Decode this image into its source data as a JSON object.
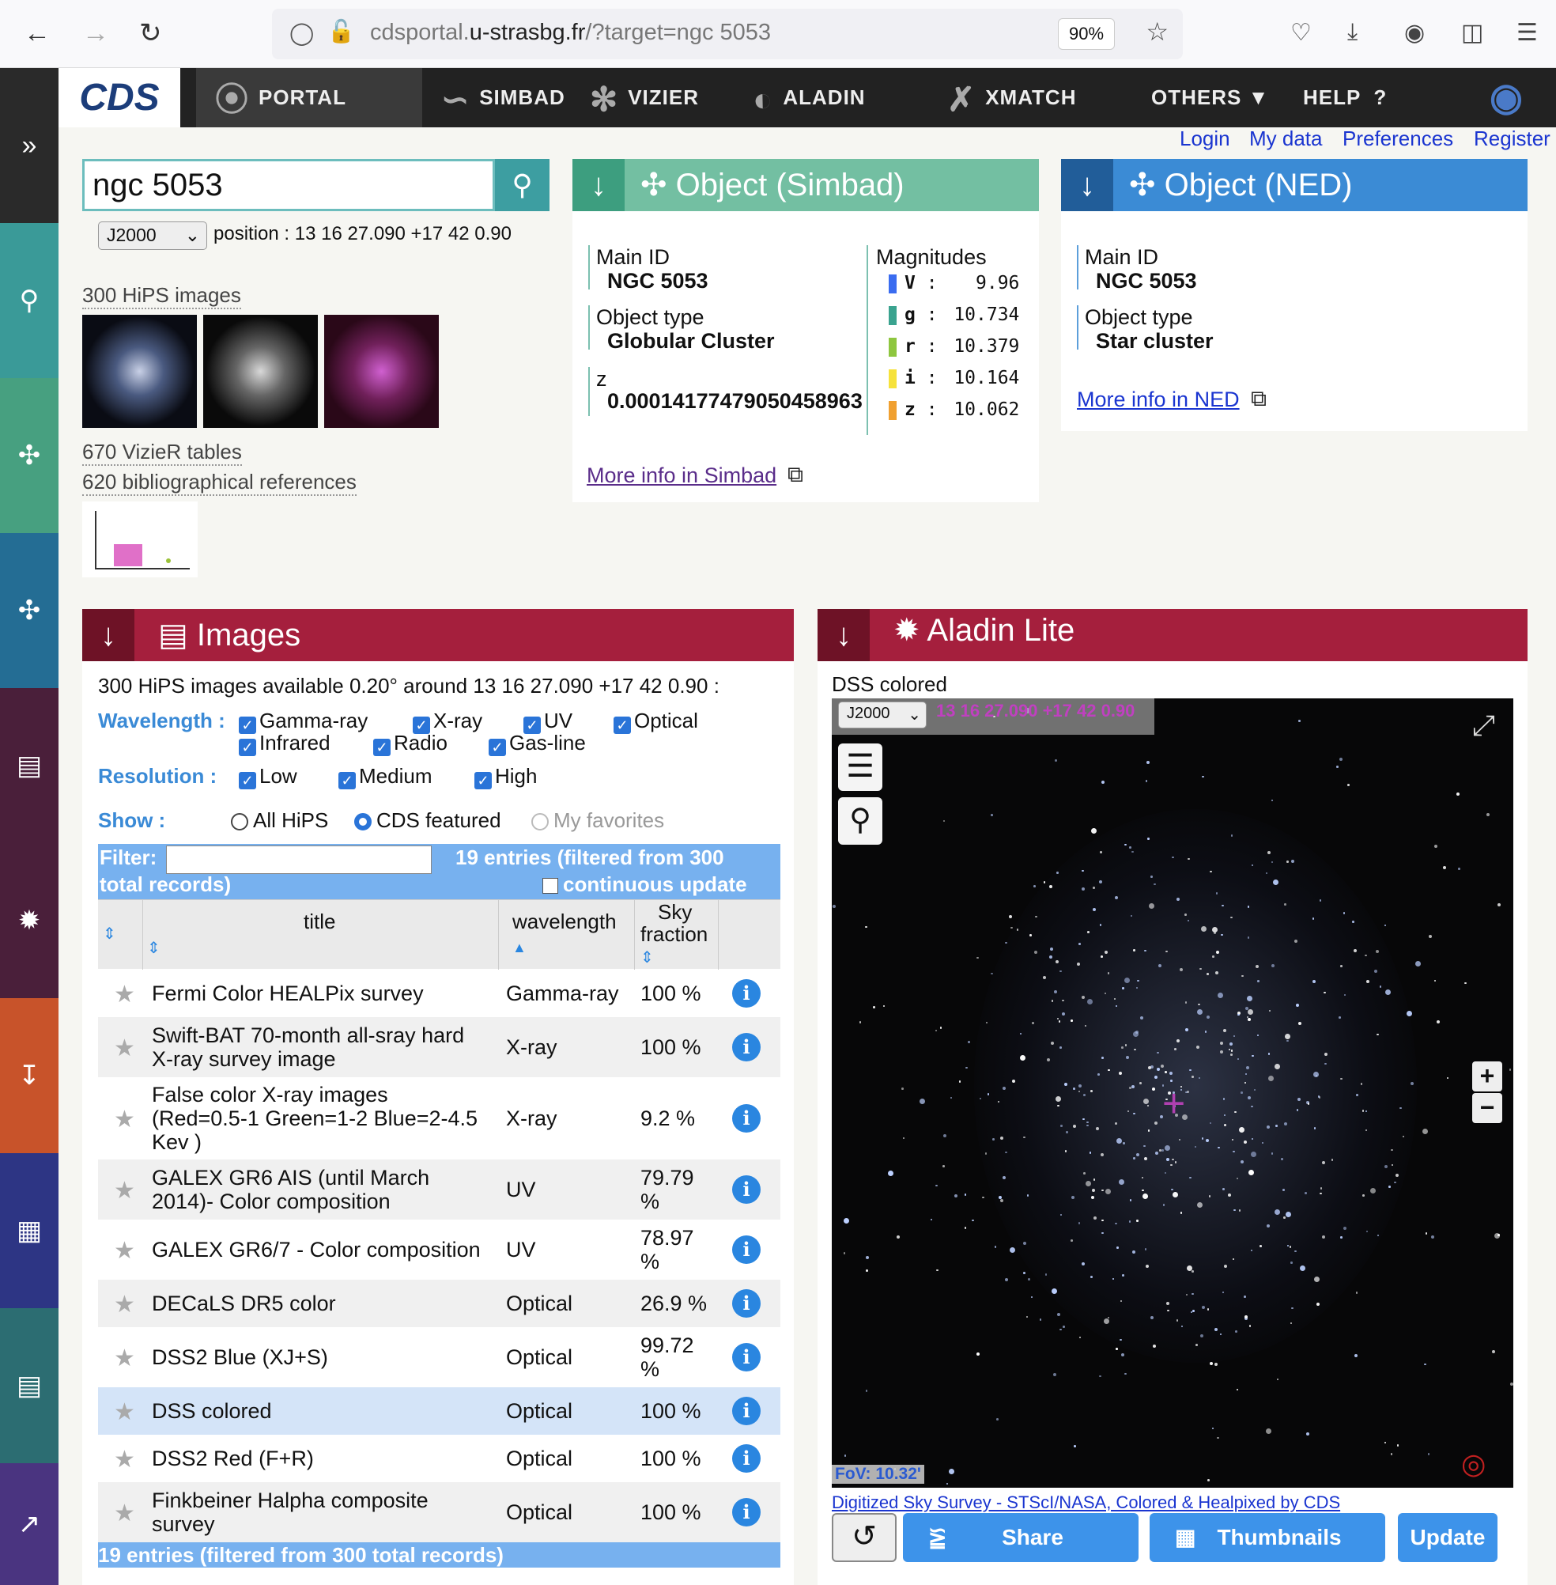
{
  "browser": {
    "url_host_prefix": "cdsportal.",
    "url_host": "u-strasbg.fr",
    "url_path": "/?target=ngc 5053",
    "zoom": "90%"
  },
  "cds_nav": {
    "logo": "CDS",
    "items": [
      "PORTAL",
      "SIMBAD",
      "VIZIER",
      "ALADIN",
      "XMATCH",
      "OTHERS",
      "HELP"
    ],
    "help_mark": "?"
  },
  "user_links": [
    "Login",
    "My data",
    "Preferences",
    "Register"
  ],
  "search": {
    "value": "ngc 5053",
    "frame": "J2000",
    "position": "position : 13 16 27.090 +17 42 0.90"
  },
  "summary": {
    "hips": "300 HiPS images",
    "vizier": "670 VizieR tables",
    "biblio": "620 bibliographical references"
  },
  "simbad": {
    "header": "Object (Simbad)",
    "main_id_label": "Main ID",
    "main_id": "NGC 5053",
    "type_label": "Object type",
    "type": "Globular Cluster",
    "z_label": "z",
    "z": "0.00014177479050458963",
    "mag_label": "Magnitudes",
    "mags": [
      {
        "band": "V",
        "value": "9.96",
        "color": "#3a6cf0"
      },
      {
        "band": "g",
        "value": "10.734",
        "color": "#3aa38f"
      },
      {
        "band": "r",
        "value": "10.379",
        "color": "#8ec63f"
      },
      {
        "band": "i",
        "value": "10.164",
        "color": "#f6e23b"
      },
      {
        "band": "z",
        "value": "10.062",
        "color": "#f0a030"
      }
    ],
    "more": "More info in Simbad"
  },
  "ned": {
    "header": "Object (NED)",
    "main_id_label": "Main ID",
    "main_id": "NGC 5053",
    "type_label": "Object type",
    "type": "Star cluster",
    "more": "More info in NED"
  },
  "images": {
    "header": "Images",
    "available": "300 HiPS images available 0.20° around 13 16 27.090 +17 42 0.90 :",
    "wavelength_label": "Wavelength :",
    "wavelengths": [
      "Gamma-ray",
      "X-ray",
      "UV",
      "Optical",
      "Infrared",
      "Radio",
      "Gas-line"
    ],
    "resolution_label": "Resolution :",
    "resolutions": [
      "Low",
      "Medium",
      "High"
    ],
    "show_label": "Show :",
    "show_options": [
      "All HiPS",
      "CDS featured",
      "My favorites"
    ],
    "filter_label": "Filter:",
    "filter_info": "19 entries (filtered from 300",
    "filter_info2": "total records)",
    "continuous": "continuous update",
    "columns": [
      "title",
      "wavelength",
      "Sky",
      "fraction"
    ],
    "rows": [
      {
        "title": [
          "Fermi Color HEALPix survey"
        ],
        "wavelength": "Gamma-ray",
        "fraction": [
          "100 %"
        ]
      },
      {
        "title": [
          "Swift-BAT 70-month all-sray hard",
          "X-ray survey image"
        ],
        "wavelength": "X-ray",
        "fraction": [
          "100 %"
        ]
      },
      {
        "title": [
          "False color X-ray images",
          "(Red=0.5-1 Green=1-2 Blue=2-4.5",
          "Kev )"
        ],
        "wavelength": "X-ray",
        "fraction": [
          "9.2 %"
        ]
      },
      {
        "title": [
          "GALEX GR6 AIS (until March",
          "2014)- Color composition"
        ],
        "wavelength": "UV",
        "fraction": [
          "79.79",
          "%"
        ]
      },
      {
        "title": [
          "GALEX GR6/7 - Color composition"
        ],
        "wavelength": "UV",
        "fraction": [
          "78.97",
          "%"
        ]
      },
      {
        "title": [
          "DECaLS DR5 color"
        ],
        "wavelength": "Optical",
        "fraction": [
          "26.9 %"
        ]
      },
      {
        "title": [
          "DSS2 Blue (XJ+S)"
        ],
        "wavelength": "Optical",
        "fraction": [
          "99.72",
          "%"
        ]
      },
      {
        "title": [
          "DSS colored"
        ],
        "wavelength": "Optical",
        "fraction": [
          "100 %"
        ]
      },
      {
        "title": [
          "DSS2 Red (F+R)"
        ],
        "wavelength": "Optical",
        "fraction": [
          "100 %"
        ]
      },
      {
        "title": [
          "Finkbeiner Halpha composite",
          "survey"
        ],
        "wavelength": "Optical",
        "fraction": [
          "100 %"
        ]
      }
    ],
    "footer": "19 entries (filtered from 300 total records)"
  },
  "aladin": {
    "header": "Aladin Lite",
    "survey": "DSS colored",
    "frame": "J2000",
    "coords": "13 16 27.090 +17 42 0.90",
    "fov": "FoV: 10.32'",
    "credit": "Digitized Sky Survey - STScI/NASA, Colored & Healpixed by CDS",
    "buttons": [
      "Share",
      "Thumbnails",
      "Update"
    ]
  }
}
